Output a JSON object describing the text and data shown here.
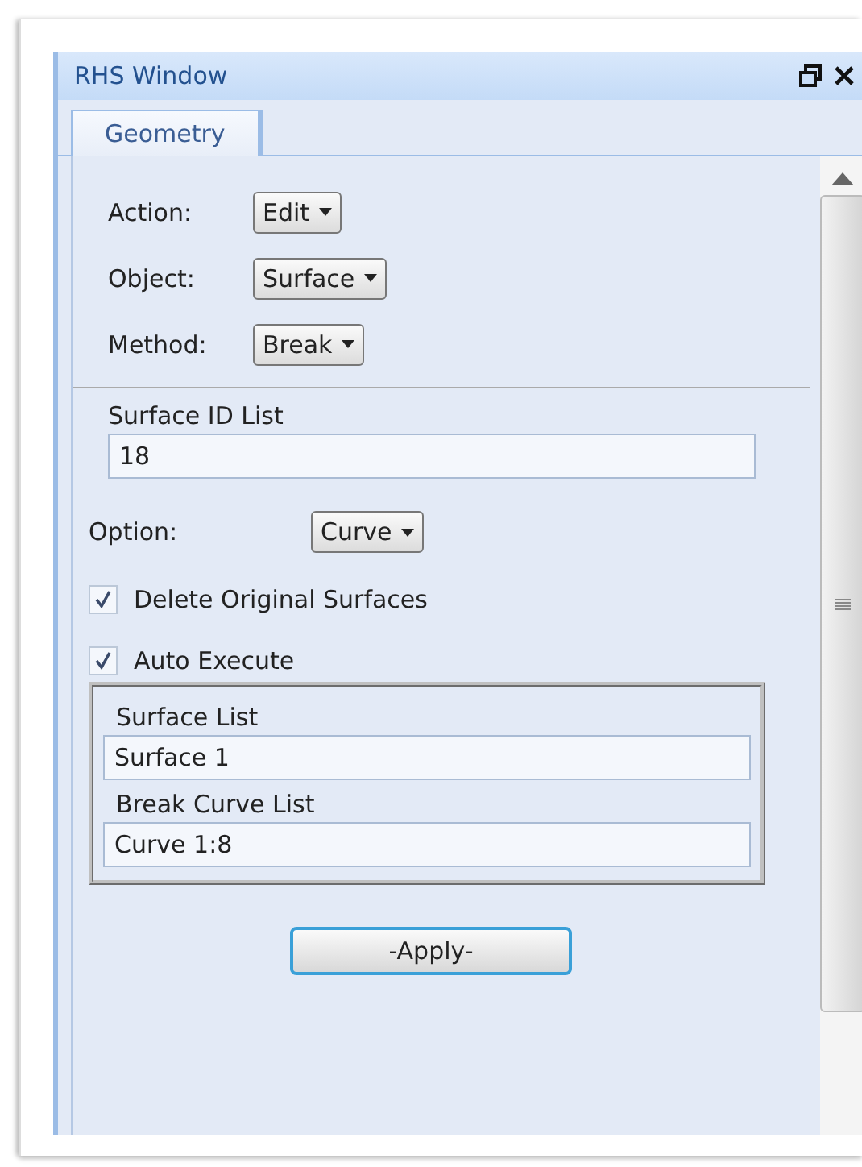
{
  "window": {
    "title": "RHS Window"
  },
  "tabs": [
    {
      "label": "Geometry",
      "selected": true
    }
  ],
  "selectors": [
    {
      "label": "Action:",
      "value": "Edit"
    },
    {
      "label": "Object:",
      "value": "Surface"
    },
    {
      "label": "Method:",
      "value": "Break"
    }
  ],
  "surface_id_list": {
    "label": "Surface ID List",
    "value": "18"
  },
  "option": {
    "label": "Option:",
    "value": "Curve"
  },
  "checkboxes": [
    {
      "label": "Delete Original Surfaces",
      "checked": true
    },
    {
      "label": "Auto Execute",
      "checked": true
    }
  ],
  "auto_execute_group": {
    "fields": [
      {
        "label": "Surface List",
        "value": "Surface 1"
      },
      {
        "label": "Break Curve List",
        "value": "Curve 1:8"
      }
    ]
  },
  "apply_button": {
    "label": "-Apply-"
  }
}
